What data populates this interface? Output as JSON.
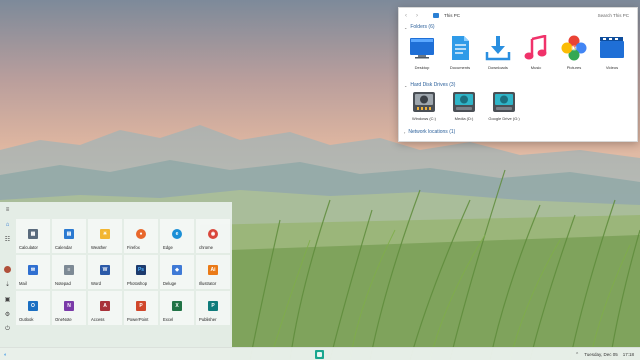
{
  "explorer": {
    "title": "This PC",
    "search_placeholder": "Search This PC",
    "folders_header": "Folders (6)",
    "folders": [
      {
        "label": "Desktop",
        "icon": "desktop-icon"
      },
      {
        "label": "Documents",
        "icon": "documents-icon"
      },
      {
        "label": "Downloads",
        "icon": "downloads-icon"
      },
      {
        "label": "Music",
        "icon": "music-icon"
      },
      {
        "label": "Pictures",
        "icon": "pictures-icon"
      },
      {
        "label": "Videos",
        "icon": "videos-icon"
      }
    ],
    "drives_header": "Hard Disk Drives (3)",
    "drives": [
      {
        "label": "Windows (C:)"
      },
      {
        "label": "Media (D:)"
      },
      {
        "label": "Google Drive (G:)"
      }
    ],
    "network_header": "Network locations (1)"
  },
  "start_menu": {
    "tiles": [
      {
        "label": "Calculator",
        "icon": "calculator-icon",
        "color": "#5a6b7d",
        "glyph": "▦"
      },
      {
        "label": "Calendar",
        "icon": "calendar-icon",
        "color": "#2b7ad1",
        "glyph": "▤"
      },
      {
        "label": "Weather",
        "icon": "weather-icon",
        "color": "#f2b632",
        "glyph": "☀"
      },
      {
        "label": "Firefox",
        "icon": "firefox-icon",
        "color": "#e8672b",
        "glyph": "●"
      },
      {
        "label": "Edge",
        "icon": "edge-icon",
        "color": "#1b8fd6",
        "glyph": "e"
      },
      {
        "label": "chrome",
        "icon": "chrome-icon",
        "color": "#d9473b",
        "glyph": "◉"
      },
      {
        "label": "Mail",
        "icon": "mail-icon",
        "color": "#2f6fd0",
        "glyph": "✉"
      },
      {
        "label": "Notepad",
        "icon": "notepad-icon",
        "color": "#7d8a95",
        "glyph": "≡"
      },
      {
        "label": "Word",
        "icon": "word-icon",
        "color": "#2b5aa8",
        "glyph": "W"
      },
      {
        "label": "Photoshop",
        "icon": "photoshop-icon",
        "color": "#1d3b6e",
        "glyph": "Ps"
      },
      {
        "label": "Deluge",
        "icon": "deluge-icon",
        "color": "#3f7ad6",
        "glyph": "◆"
      },
      {
        "label": "Illustrator",
        "icon": "illustrator-icon",
        "color": "#ea7a17",
        "glyph": "Ai"
      },
      {
        "label": "Outlook",
        "icon": "outlook-icon",
        "color": "#1b6fc2",
        "glyph": "O"
      },
      {
        "label": "OneNote",
        "icon": "onenote-icon",
        "color": "#7a3aa8",
        "glyph": "N"
      },
      {
        "label": "Access",
        "icon": "access-icon",
        "color": "#a8333a",
        "glyph": "A"
      },
      {
        "label": "PowerPoint",
        "icon": "powerpoint-icon",
        "color": "#d0472b",
        "glyph": "P"
      },
      {
        "label": "Excel",
        "icon": "excel-icon",
        "color": "#217346",
        "glyph": "X"
      },
      {
        "label": "Publisher",
        "icon": "publisher-icon",
        "color": "#0f7b7b",
        "glyph": "P"
      }
    ]
  },
  "taskbar": {
    "date": "Tuesday,  Dec 05",
    "time": "17:18"
  }
}
